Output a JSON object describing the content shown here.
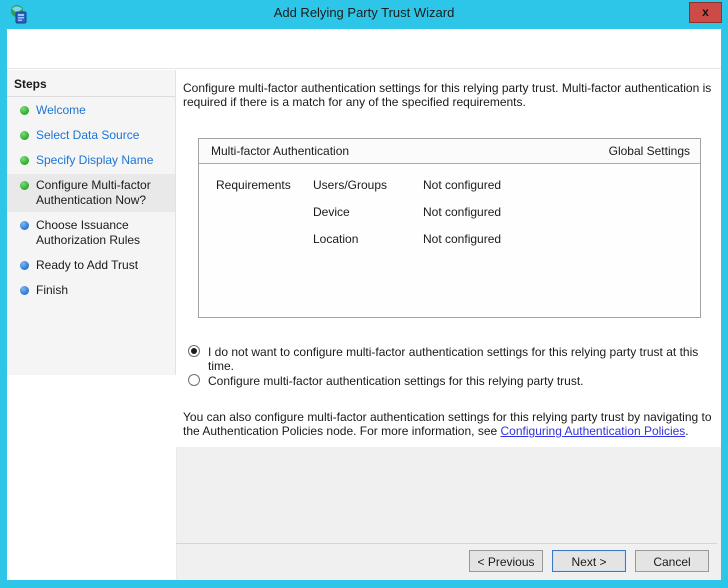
{
  "window": {
    "title": "Add Relying Party Trust Wizard",
    "close_label": "x"
  },
  "sidebar": {
    "header": "Steps",
    "items": [
      {
        "label": "Welcome",
        "bullet": "green",
        "state": "completed"
      },
      {
        "label": "Select Data Source",
        "bullet": "green",
        "state": "completed"
      },
      {
        "label": "Specify Display Name",
        "bullet": "green",
        "state": "completed"
      },
      {
        "label": "Configure Multi-factor Authentication Now?",
        "bullet": "green",
        "state": "current"
      },
      {
        "label": "Choose Issuance Authorization Rules",
        "bullet": "blue",
        "state": "pending"
      },
      {
        "label": "Ready to Add Trust",
        "bullet": "blue",
        "state": "pending"
      },
      {
        "label": "Finish",
        "bullet": "blue",
        "state": "pending"
      }
    ]
  },
  "main": {
    "intro": "Configure multi-factor authentication settings for this relying party trust. Multi-factor authentication is required if there is a match for any of the specified requirements.",
    "panel": {
      "title": "Multi-factor Authentication",
      "right_label": "Global Settings",
      "rows_label": "Requirements",
      "rows": [
        {
          "name": "Users/Groups",
          "value": "Not configured"
        },
        {
          "name": "Device",
          "value": "Not configured"
        },
        {
          "name": "Location",
          "value": "Not configured"
        }
      ]
    },
    "radios": [
      {
        "label": "I do not want to configure multi-factor authentication settings for this relying party trust at this time.",
        "selected": true
      },
      {
        "label": "Configure multi-factor authentication settings for this relying party trust.",
        "selected": false
      }
    ],
    "footnote": {
      "before": "You can also configure multi-factor authentication settings for this relying party trust by navigating to the Authentication Policies node. For more information, see ",
      "link": "Configuring Authentication Policies",
      "after": "."
    }
  },
  "footer": {
    "buttons": [
      {
        "label": "< Previous"
      },
      {
        "label": "Next >"
      },
      {
        "label": "Cancel"
      }
    ]
  },
  "colors": {
    "titlebar": "#2dc6e8",
    "close_button": "#cd4b46",
    "sidebar_bg": "#f5f5f5",
    "current_step_highlight": "#e9e9e9",
    "completed_bullet": "#2eb02e",
    "pending_bullet": "#2b7cd4",
    "step_link": "#1b75d4",
    "inline_link": "#3232e0",
    "footer_bg": "#f0f0f0"
  }
}
